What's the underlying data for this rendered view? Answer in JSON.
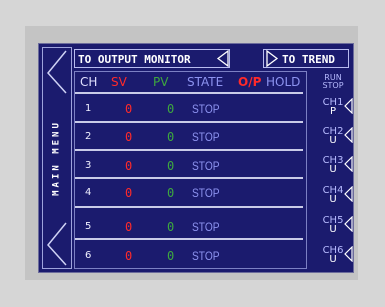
{
  "nav": {
    "to_output_monitor": "TO OUTPUT MONITOR",
    "to_trend": "TO TREND",
    "main_menu": "MAIN MENU"
  },
  "table": {
    "headers": {
      "ch": "CH",
      "sv": "SV",
      "pv": "PV",
      "state": "STATE",
      "op": "O/P",
      "hold": "HOLD"
    },
    "rows": [
      {
        "ch": "1",
        "sv": "0",
        "pv": "0",
        "state": "STOP"
      },
      {
        "ch": "2",
        "sv": "0",
        "pv": "0",
        "state": "STOP"
      },
      {
        "ch": "3",
        "sv": "0",
        "pv": "0",
        "state": "STOP"
      },
      {
        "ch": "4",
        "sv": "0",
        "pv": "0",
        "state": "STOP"
      },
      {
        "ch": "5",
        "sv": "0",
        "pv": "0",
        "state": "STOP"
      },
      {
        "ch": "6",
        "sv": "0",
        "pv": "0",
        "state": "STOP"
      }
    ]
  },
  "run_stop": {
    "run": "RUN",
    "stop": "STOP"
  },
  "channel_buttons": [
    {
      "label": "CH1",
      "mode": "P"
    },
    {
      "label": "CH2",
      "mode": "U"
    },
    {
      "label": "CH3",
      "mode": "U"
    },
    {
      "label": "CH4",
      "mode": "U"
    },
    {
      "label": "CH5",
      "mode": "U"
    },
    {
      "label": "CH6",
      "mode": "U"
    }
  ],
  "colors": {
    "screen_bg": "#1b1b6e",
    "sv": "#ff2a2a",
    "pv": "#3ea83e",
    "state": "#8d93f0",
    "op": "#ff2a2a"
  }
}
